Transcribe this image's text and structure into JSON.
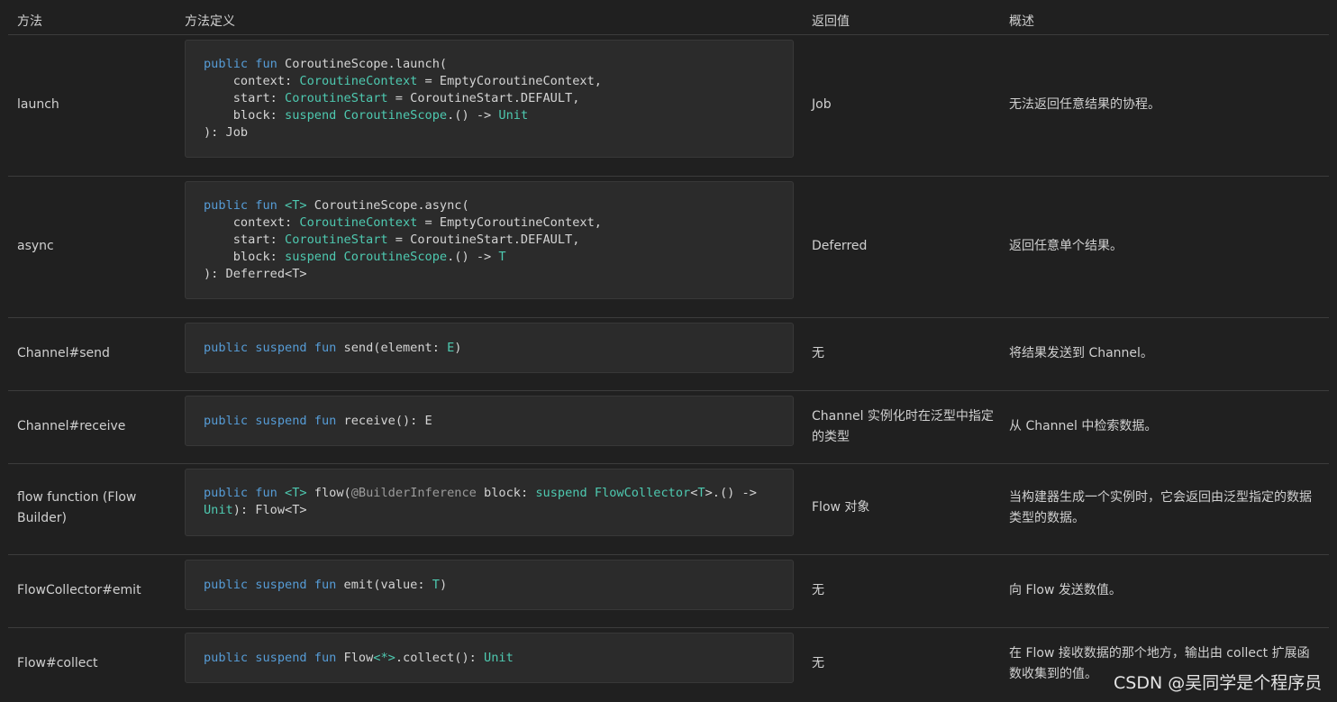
{
  "headers": {
    "method": "方法",
    "definition": "方法定义",
    "returns": "返回值",
    "description": "概述"
  },
  "rows": [
    {
      "method": "launch",
      "code_lines": [
        [
          [
            "kw",
            "public"
          ],
          [
            "p",
            " "
          ],
          [
            "kw",
            "fun"
          ],
          [
            "p",
            " CoroutineScope.launch("
          ]
        ],
        [
          [
            "p",
            "    context: "
          ],
          [
            "ty",
            "CoroutineContext"
          ],
          [
            "p",
            " = EmptyCoroutineContext,"
          ]
        ],
        [
          [
            "p",
            "    start: "
          ],
          [
            "ty",
            "CoroutineStart"
          ],
          [
            "p",
            " = CoroutineStart.DEFAULT,"
          ]
        ],
        [
          [
            "p",
            "    block: "
          ],
          [
            "ty",
            "suspend"
          ],
          [
            "p",
            " "
          ],
          [
            "ty",
            "CoroutineScope"
          ],
          [
            "p",
            ".() -> "
          ],
          [
            "ty",
            "Unit"
          ]
        ],
        [
          [
            "p",
            "): Job"
          ]
        ]
      ],
      "returns": "Job",
      "description": "无法返回任意结果的协程。"
    },
    {
      "method": "async",
      "code_lines": [
        [
          [
            "kw",
            "public"
          ],
          [
            "p",
            " "
          ],
          [
            "kw",
            "fun"
          ],
          [
            "p",
            " "
          ],
          [
            "ty",
            "<T>"
          ],
          [
            "p",
            " CoroutineScope.async("
          ]
        ],
        [
          [
            "p",
            "    context: "
          ],
          [
            "ty",
            "CoroutineContext"
          ],
          [
            "p",
            " = EmptyCoroutineContext,"
          ]
        ],
        [
          [
            "p",
            "    start: "
          ],
          [
            "ty",
            "CoroutineStart"
          ],
          [
            "p",
            " = CoroutineStart.DEFAULT,"
          ]
        ],
        [
          [
            "p",
            "    block: "
          ],
          [
            "ty",
            "suspend"
          ],
          [
            "p",
            " "
          ],
          [
            "ty",
            "CoroutineScope"
          ],
          [
            "p",
            ".() -> "
          ],
          [
            "ty",
            "T"
          ]
        ],
        [
          [
            "p",
            "): Deferred<T>"
          ]
        ]
      ],
      "returns": "Deferred",
      "description": "返回任意单个结果。"
    },
    {
      "method": "Channel#send",
      "code_lines": [
        [
          [
            "kw",
            "public"
          ],
          [
            "p",
            " "
          ],
          [
            "kw",
            "suspend"
          ],
          [
            "p",
            " "
          ],
          [
            "kw",
            "fun"
          ],
          [
            "p",
            " send(element: "
          ],
          [
            "ty",
            "E"
          ],
          [
            "p",
            ")"
          ]
        ]
      ],
      "returns": "无",
      "description": "将结果发送到 Channel。"
    },
    {
      "method": "Channel#receive",
      "code_lines": [
        [
          [
            "kw",
            "public"
          ],
          [
            "p",
            " "
          ],
          [
            "kw",
            "suspend"
          ],
          [
            "p",
            " "
          ],
          [
            "kw",
            "fun"
          ],
          [
            "p",
            " receive(): E"
          ]
        ]
      ],
      "returns": "Channel 实例化时在泛型中指定的类型",
      "description": "从 Channel 中检索数据。"
    },
    {
      "method": "flow function (Flow Builder)",
      "code_lines": [
        [
          [
            "kw",
            "public"
          ],
          [
            "p",
            " "
          ],
          [
            "kw",
            "fun"
          ],
          [
            "p",
            " "
          ],
          [
            "ty",
            "<T>"
          ],
          [
            "p",
            " flow("
          ],
          [
            "an",
            "@BuilderInference"
          ],
          [
            "p",
            " block: "
          ],
          [
            "ty",
            "suspend"
          ],
          [
            "p",
            " "
          ],
          [
            "ty",
            "FlowCollector"
          ],
          [
            "p",
            "<"
          ],
          [
            "ty",
            "T"
          ],
          [
            "p",
            ">.() ->"
          ]
        ],
        [
          [
            "ty",
            "Unit"
          ],
          [
            "p",
            "): Flow<T>"
          ]
        ]
      ],
      "returns": "Flow 对象",
      "description": "当构建器生成一个实例时，它会返回由泛型指定的数据类型的数据。"
    },
    {
      "method": "FlowCollector#emit",
      "code_lines": [
        [
          [
            "kw",
            "public"
          ],
          [
            "p",
            " "
          ],
          [
            "kw",
            "suspend"
          ],
          [
            "p",
            " "
          ],
          [
            "kw",
            "fun"
          ],
          [
            "p",
            " emit(value: "
          ],
          [
            "ty",
            "T"
          ],
          [
            "p",
            ")"
          ]
        ]
      ],
      "returns": "无",
      "description": "向 Flow 发送数值。"
    },
    {
      "method": "Flow#collect",
      "code_lines": [
        [
          [
            "kw",
            "public"
          ],
          [
            "p",
            " "
          ],
          [
            "kw",
            "suspend"
          ],
          [
            "p",
            " "
          ],
          [
            "kw",
            "fun"
          ],
          [
            "p",
            " Flow"
          ],
          [
            "ty",
            "<*>"
          ],
          [
            "p",
            ".collect(): "
          ],
          [
            "ty",
            "Unit"
          ]
        ]
      ],
      "returns": "无",
      "description": "在 Flow 接收数据的那个地方，输出由 collect 扩展函数收集到的值。"
    }
  ],
  "watermark": "CSDN @吴同学是个程序员"
}
